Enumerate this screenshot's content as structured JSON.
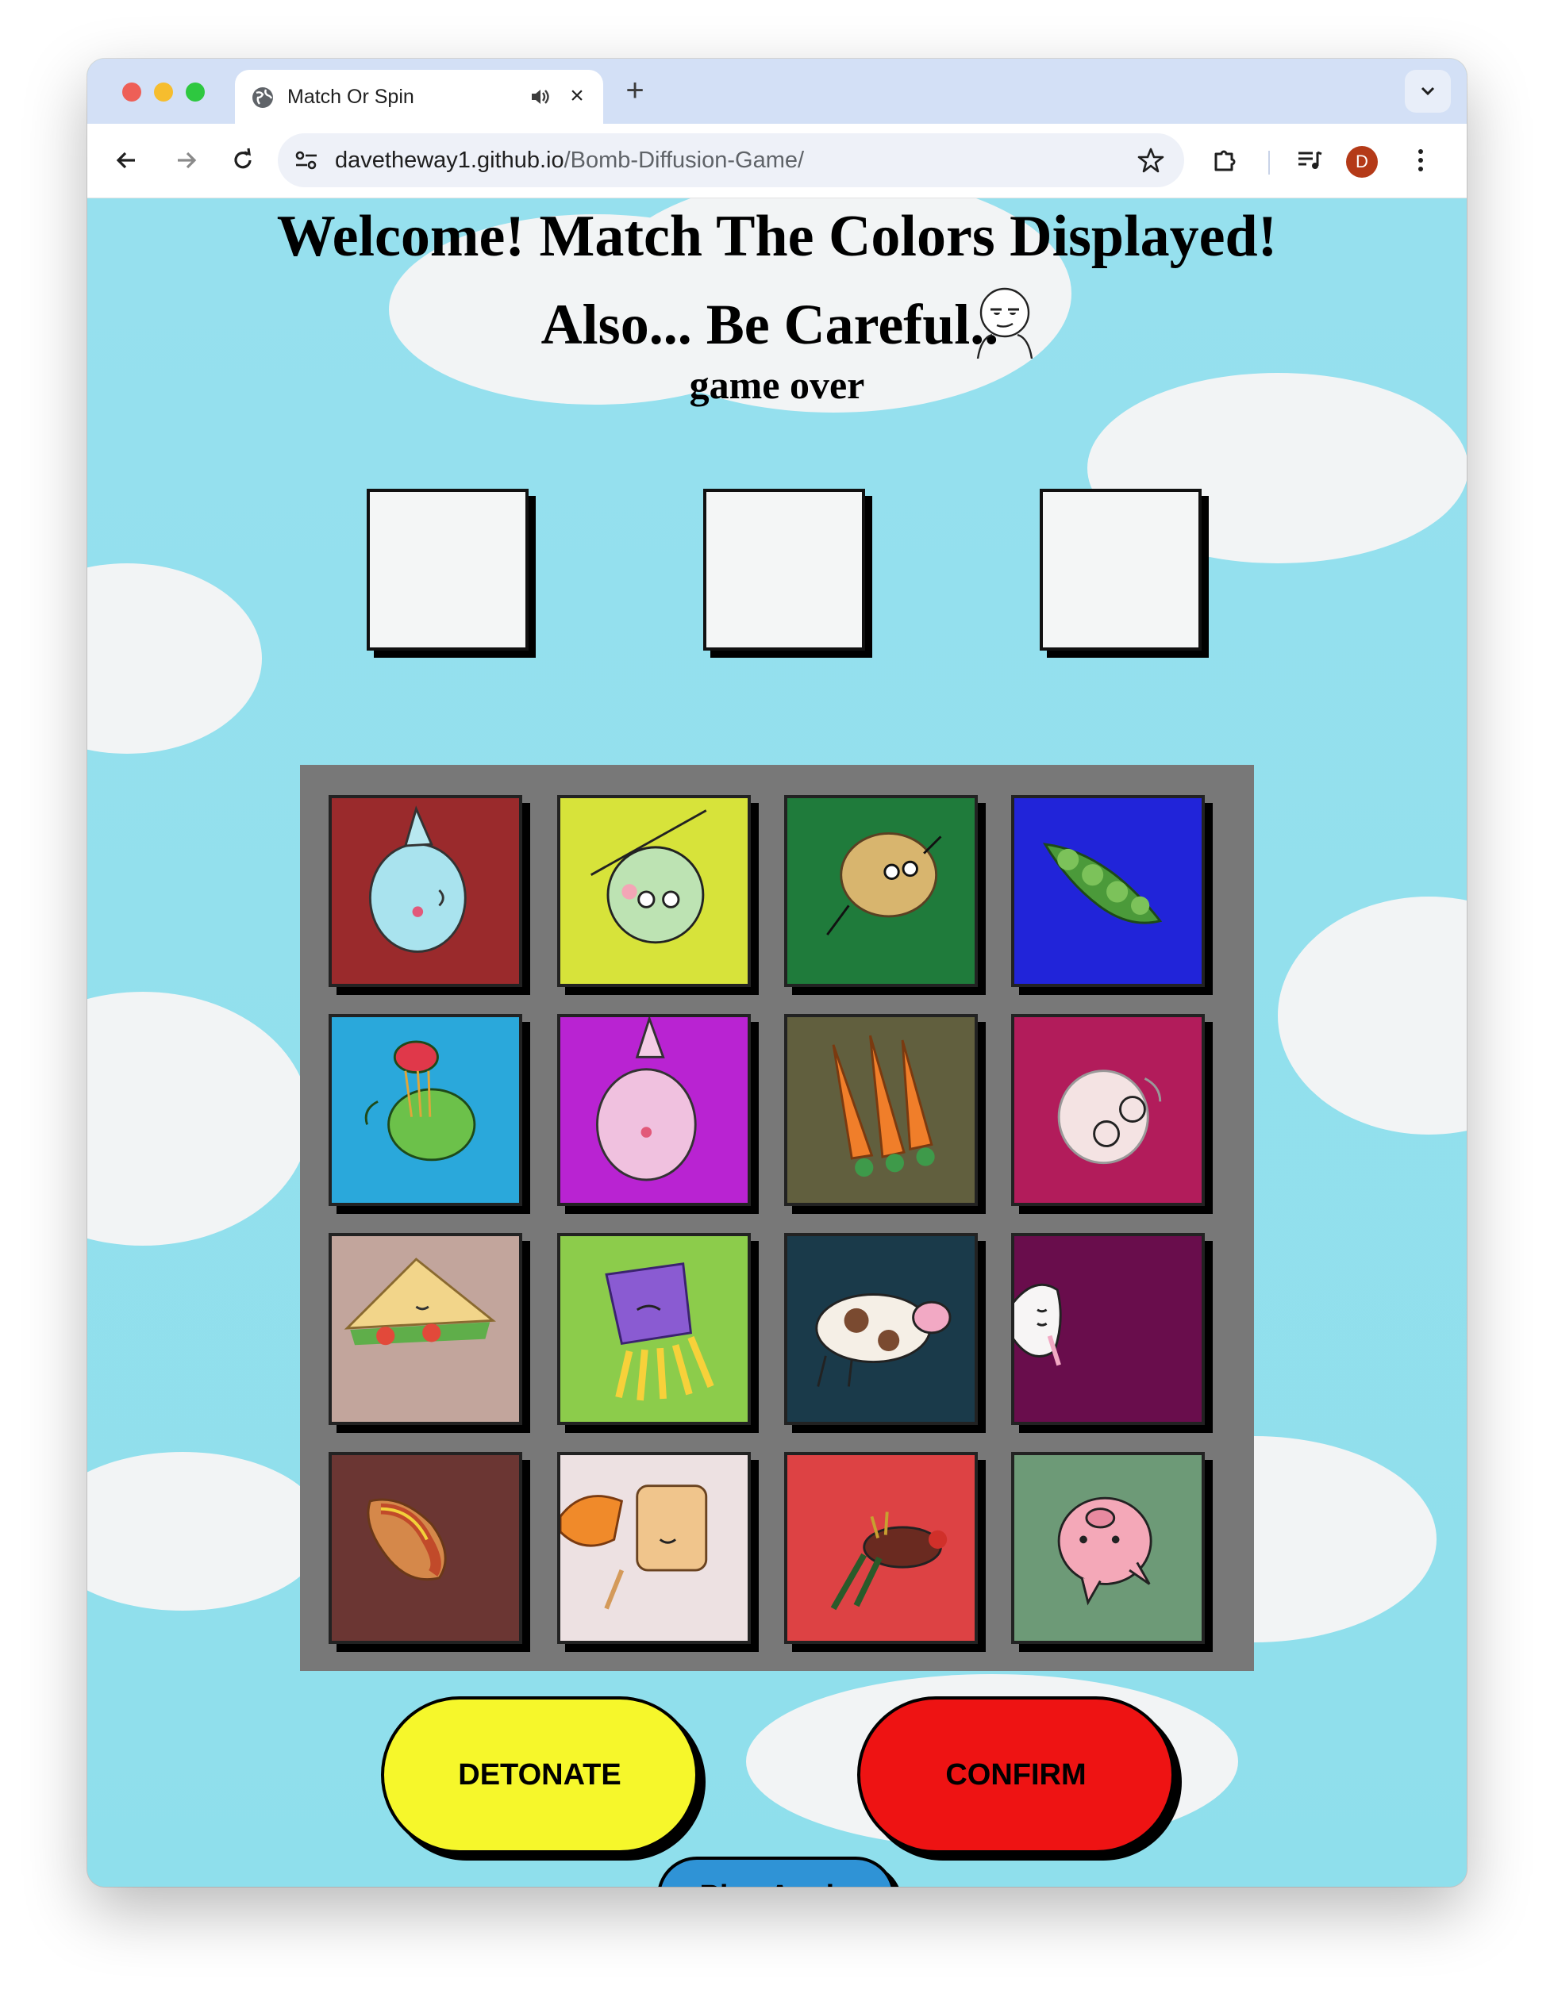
{
  "browser": {
    "tab_title": "Match Or Spin",
    "url_host": "davetheway1.github.io",
    "url_path": "/Bomb-Diffusion-Game/",
    "profile_initial": "D"
  },
  "page": {
    "heading": "Welcome! Match The Colors Displayed!",
    "subheading": "Also... Be Careful..",
    "status": "game over"
  },
  "targets": [
    {
      "color": "#f4f6f6"
    },
    {
      "color": "#f4f6f6"
    },
    {
      "color": "#f4f6f6"
    }
  ],
  "tiles": [
    {
      "color": "#9a2a2c",
      "icon": "dinosaur-icon"
    },
    {
      "color": "#d7e33a",
      "icon": "bear-icon"
    },
    {
      "color": "#1f7b3b",
      "icon": "potato-icon"
    },
    {
      "color": "#2124d9",
      "icon": "peapod-icon"
    },
    {
      "color": "#2aa8db",
      "icon": "turtle-icon"
    },
    {
      "color": "#b923d2",
      "icon": "unicorn-icon"
    },
    {
      "color": "#615f3e",
      "icon": "carrots-icon"
    },
    {
      "color": "#b21c5b",
      "icon": "garlic-icon"
    },
    {
      "color": "#c2a59c",
      "icon": "sandwich-icon"
    },
    {
      "color": "#8ccc4b",
      "icon": "fries-icon"
    },
    {
      "color": "#1a3a4a",
      "icon": "cow-icon"
    },
    {
      "color": "#690d4c",
      "icon": "llama-icon"
    },
    {
      "color": "#6b3633",
      "icon": "hotdog-icon"
    },
    {
      "color": "#ede1e2",
      "icon": "toast-icon"
    },
    {
      "color": "#dd4244",
      "icon": "rooster-icon"
    },
    {
      "color": "#6d9a77",
      "icon": "pig-icon"
    }
  ],
  "buttons": {
    "detonate": "DETONATE",
    "confirm": "CONFIRM",
    "play_again": "Play Again"
  }
}
